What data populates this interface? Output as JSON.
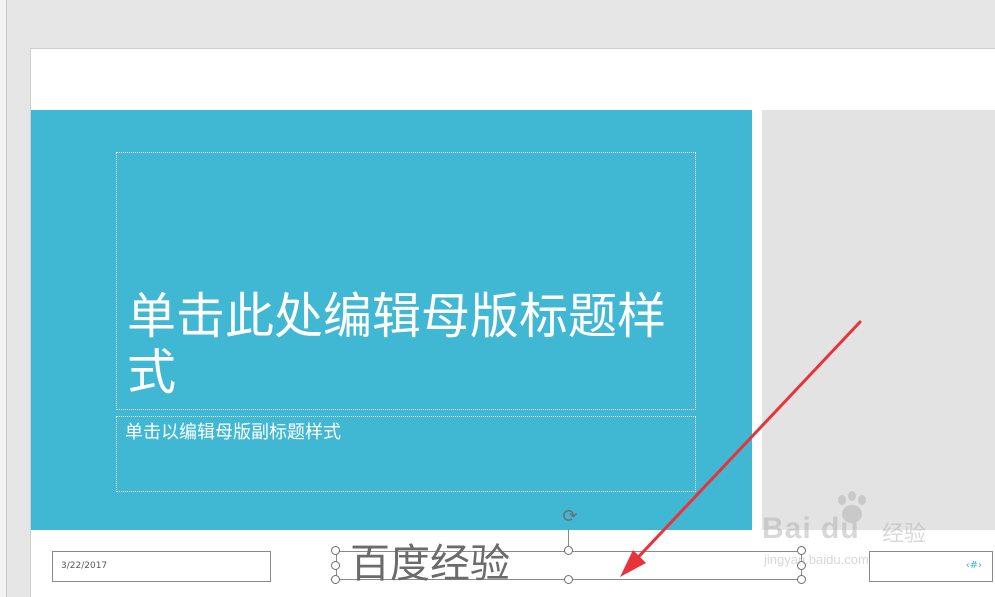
{
  "slide": {
    "title_placeholder": "单击此处编辑母版标题样式",
    "subtitle_placeholder": "单击以编辑母版副标题样式",
    "footer": {
      "date": "3/22/2017",
      "text": "百度经验",
      "slide_number": "‹#›"
    }
  },
  "watermark": {
    "brand": "Bai du",
    "brand_cn": "经验",
    "url": "jingyan.baidu.com"
  },
  "colors": {
    "title_panel": "#40b8d3",
    "right_panel": "#e3e3e3",
    "arrow": "#e8333a"
  },
  "icons": {
    "rotate": "rotate-handle-icon",
    "arrow": "red-arrow-annotation"
  }
}
